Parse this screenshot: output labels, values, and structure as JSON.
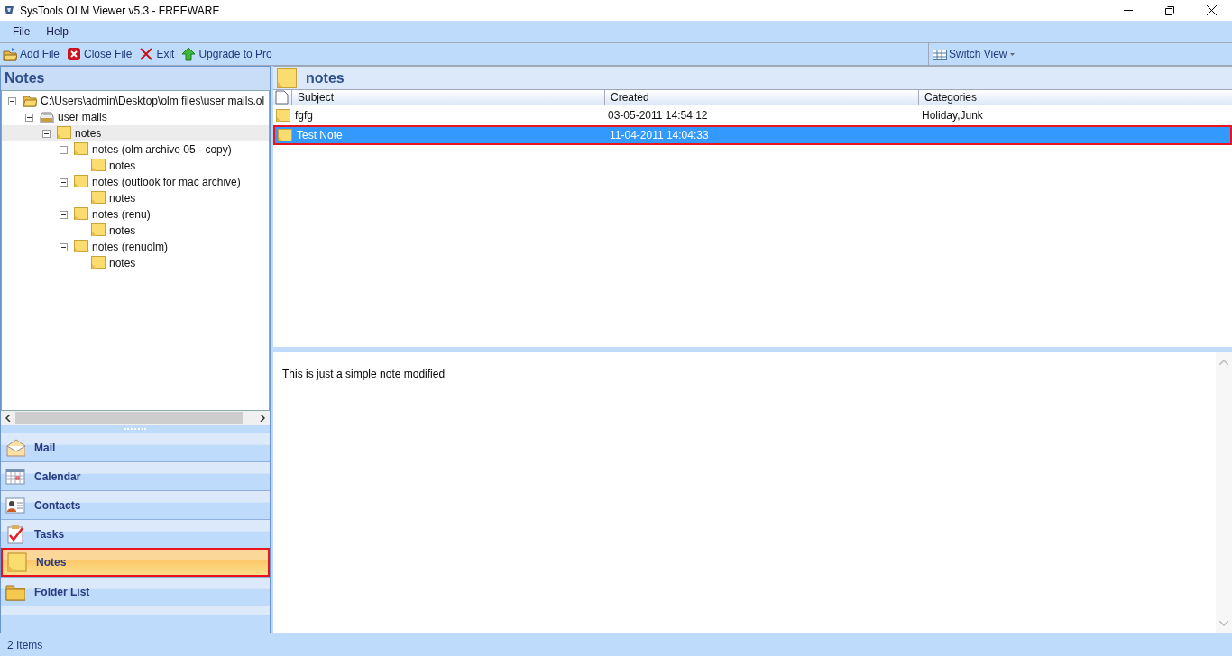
{
  "window": {
    "title": "SysTools OLM Viewer v5.3 - FREEWARE"
  },
  "menu": [
    "File",
    "Help"
  ],
  "toolbar": [
    {
      "kind": "add",
      "label": "Add File"
    },
    {
      "kind": "close",
      "label": "Close File"
    },
    {
      "kind": "exit",
      "label": "Exit"
    },
    {
      "kind": "upgrade",
      "label": "Upgrade to Pro"
    }
  ],
  "switch_view": {
    "label": "Switch View"
  },
  "sidebar": {
    "title": "Notes",
    "tree": [
      {
        "kind": "folder",
        "label": "C:\\Users\\admin\\Desktop\\olm files\\user mails.ol",
        "expanded": true,
        "selected": false,
        "children": [
          {
            "kind": "drive",
            "label": "user mails",
            "expanded": true,
            "selected": false,
            "children": [
              {
                "kind": "note",
                "label": "notes",
                "expanded": true,
                "selected": true,
                "children": [
                  {
                    "kind": "note",
                    "label": "notes (olm archive 05 - copy)",
                    "expanded": true,
                    "selected": false,
                    "children": [
                      {
                        "kind": "note",
                        "label": "notes",
                        "selected": false
                      }
                    ]
                  },
                  {
                    "kind": "note",
                    "label": "notes (outlook for mac archive)",
                    "expanded": true,
                    "selected": false,
                    "children": [
                      {
                        "kind": "note",
                        "label": "notes",
                        "selected": false
                      }
                    ]
                  },
                  {
                    "kind": "note",
                    "label": "notes (renu)",
                    "expanded": true,
                    "selected": false,
                    "children": [
                      {
                        "kind": "note",
                        "label": "notes",
                        "selected": false
                      }
                    ]
                  },
                  {
                    "kind": "note",
                    "label": "notes (renuolm)",
                    "expanded": true,
                    "selected": false,
                    "children": [
                      {
                        "kind": "note",
                        "label": "notes",
                        "selected": false
                      }
                    ]
                  }
                ]
              }
            ]
          }
        ]
      }
    ],
    "nav": [
      {
        "kind": "mail",
        "label": "Mail",
        "selected": false
      },
      {
        "kind": "calendar",
        "label": "Calendar",
        "selected": false
      },
      {
        "kind": "contacts",
        "label": "Contacts",
        "selected": false
      },
      {
        "kind": "tasks",
        "label": "Tasks",
        "selected": false
      },
      {
        "kind": "notes",
        "label": "Notes",
        "selected": true
      },
      {
        "kind": "folder",
        "label": "Folder List",
        "selected": false
      }
    ]
  },
  "list": {
    "title": "notes",
    "columns": [
      "Subject",
      "Created",
      "Categories"
    ],
    "rows": [
      {
        "cells": [
          "fgfg",
          "03-05-2011 14:54:12",
          "Holiday,Junk"
        ],
        "selected": false
      },
      {
        "cells": [
          "Test Note",
          "11-04-2011 14:04:33",
          ""
        ],
        "selected": true
      }
    ]
  },
  "preview": {
    "text": "This is just a simple note modified"
  },
  "status_bar": "2 Items"
}
